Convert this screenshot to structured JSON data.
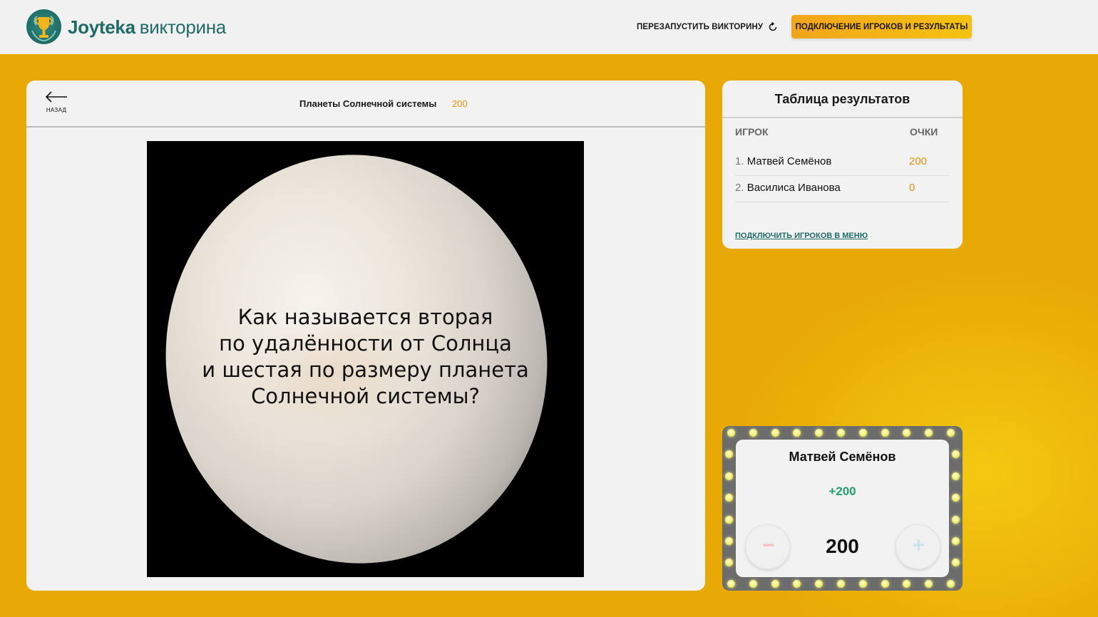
{
  "header": {
    "brand_bold": "Joyteka",
    "brand_thin": "викторина",
    "restart_label": "ПЕРЕЗАПУСТИТЬ ВИКТОРИНУ",
    "connect_label": "ПОДКЛЮЧЕНИЕ ИГРОКОВ И РЕЗУЛЬТАТЫ"
  },
  "question": {
    "back_label": "НАЗАД",
    "category": "Планеты Солнечной системы",
    "points": "200",
    "text": "Как называется вторая\nпо удалённости от Солнца\nи шестая по размеру планета\nСолнечной системы?"
  },
  "results": {
    "title": "Таблица результатов",
    "col_player": "ИГРОК",
    "col_score": "ОЧКИ",
    "rows": [
      {
        "num": "1.",
        "name": "Матвей Семёнов",
        "score": "200"
      },
      {
        "num": "2.",
        "name": "Василиса Иванова",
        "score": "0"
      }
    ],
    "menu_link": "ПОДКЛЮЧИТЬ ИГРОКОВ В МЕНЮ"
  },
  "current_player": {
    "name": "Матвей Семёнов",
    "delta": "+200",
    "score": "200",
    "minus_symbol": "−",
    "plus_symbol": "+"
  },
  "colors": {
    "background": "#e8a905",
    "brand": "#1f6b66",
    "accent": "#e8910a",
    "positive": "#22a06b"
  }
}
